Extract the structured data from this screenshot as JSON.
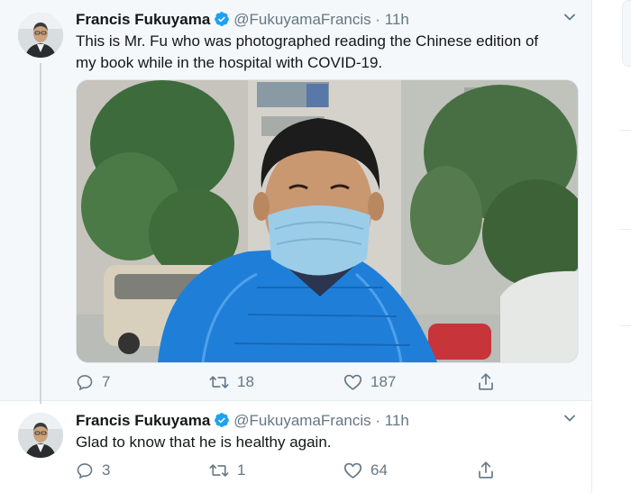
{
  "tweets": [
    {
      "name": "Francis Fukuyama",
      "handle": "@FukuyamaFrancis",
      "separator": "·",
      "time": "11h",
      "text_line1": "This is Mr. Fu who was photographed reading the Chinese edition of",
      "text_line2": "my book while in the hospital with COVID-19.",
      "replies": "7",
      "retweets": "18",
      "likes": "187"
    },
    {
      "name": "Francis Fukuyama",
      "handle": "@FukuyamaFrancis",
      "separator": "·",
      "time": "11h",
      "text_line1": "Glad to know that he is healthy again.",
      "replies": "3",
      "retweets": "1",
      "likes": "64"
    }
  ],
  "icons": {
    "verified": "verified-badge-icon",
    "caret": "chevron-down-icon",
    "reply": "reply-icon",
    "retweet": "retweet-icon",
    "like": "heart-icon",
    "share": "share-icon"
  },
  "colors": {
    "accent": "#1da1f2",
    "secondary_text": "#657786",
    "highlight_bg": "#f5f8fa"
  }
}
